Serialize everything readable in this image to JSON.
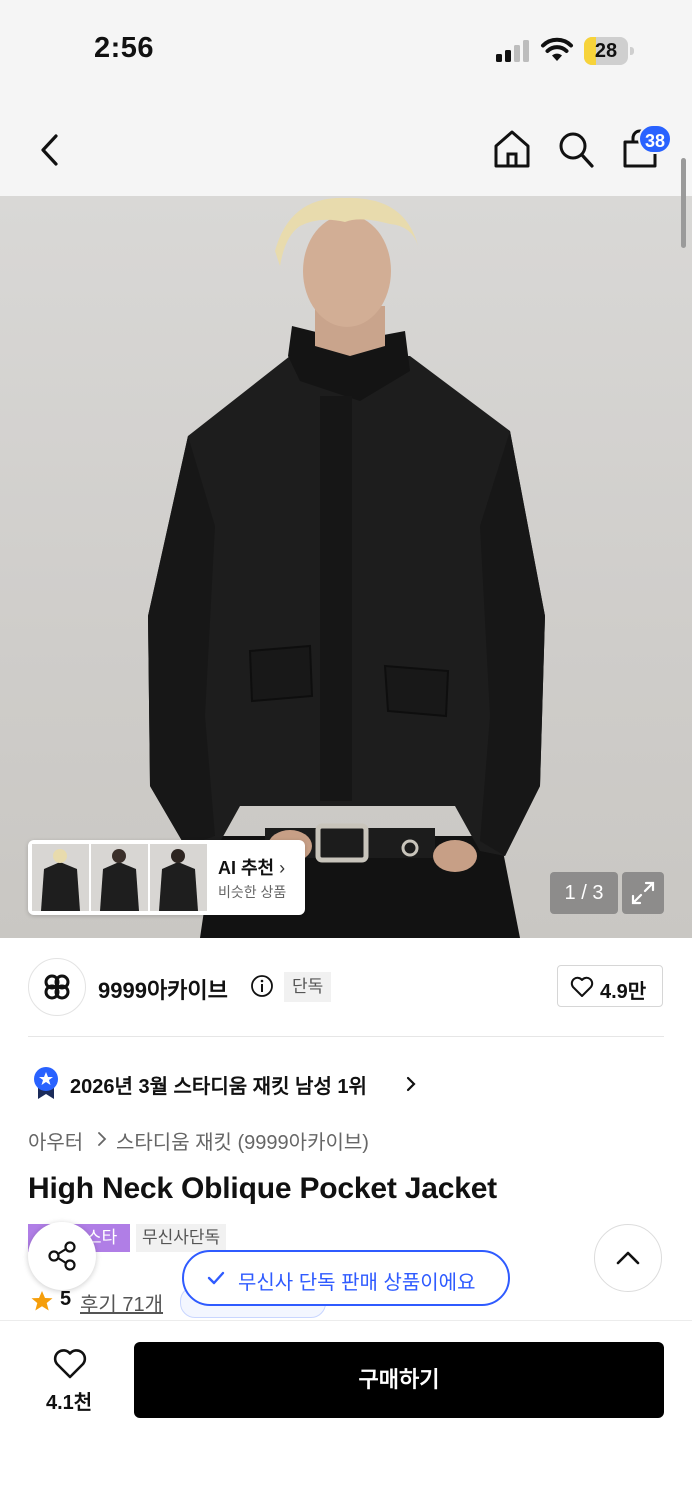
{
  "status_bar": {
    "time": "2:56",
    "battery": "28",
    "battery_level": 0.28
  },
  "nav": {
    "cart_count": "38"
  },
  "gallery": {
    "ai_label": "AI 추천",
    "ai_sub": "비슷한 상품",
    "page_indicator": "1 / 3"
  },
  "brand": {
    "name": "9999아카이브",
    "exclusive_tag": "단독",
    "likes": "4.9만"
  },
  "ranking": {
    "text": "2026년 3월 스타디움 재킷 남성 1위"
  },
  "breadcrumb": {
    "category": "아우터",
    "subcategory": "스타디움 재킷 (9999아카이브)"
  },
  "product": {
    "title": "High Neck Oblique Pocket Jacket",
    "badge_purple": "스타",
    "badge_grey": "무신사단독",
    "rating": "5",
    "reviews": "후기 71개"
  },
  "toast": {
    "text": "무신사 단독 판매 상품이에요"
  },
  "bottom_bar": {
    "fav_count": "4.1천",
    "buy_label": "구매하기"
  },
  "colors": {
    "accent": "#2962ff",
    "toast_blue": "#2f5bff",
    "badge_purple": "#b07ee6",
    "star": "#f59e0b"
  }
}
